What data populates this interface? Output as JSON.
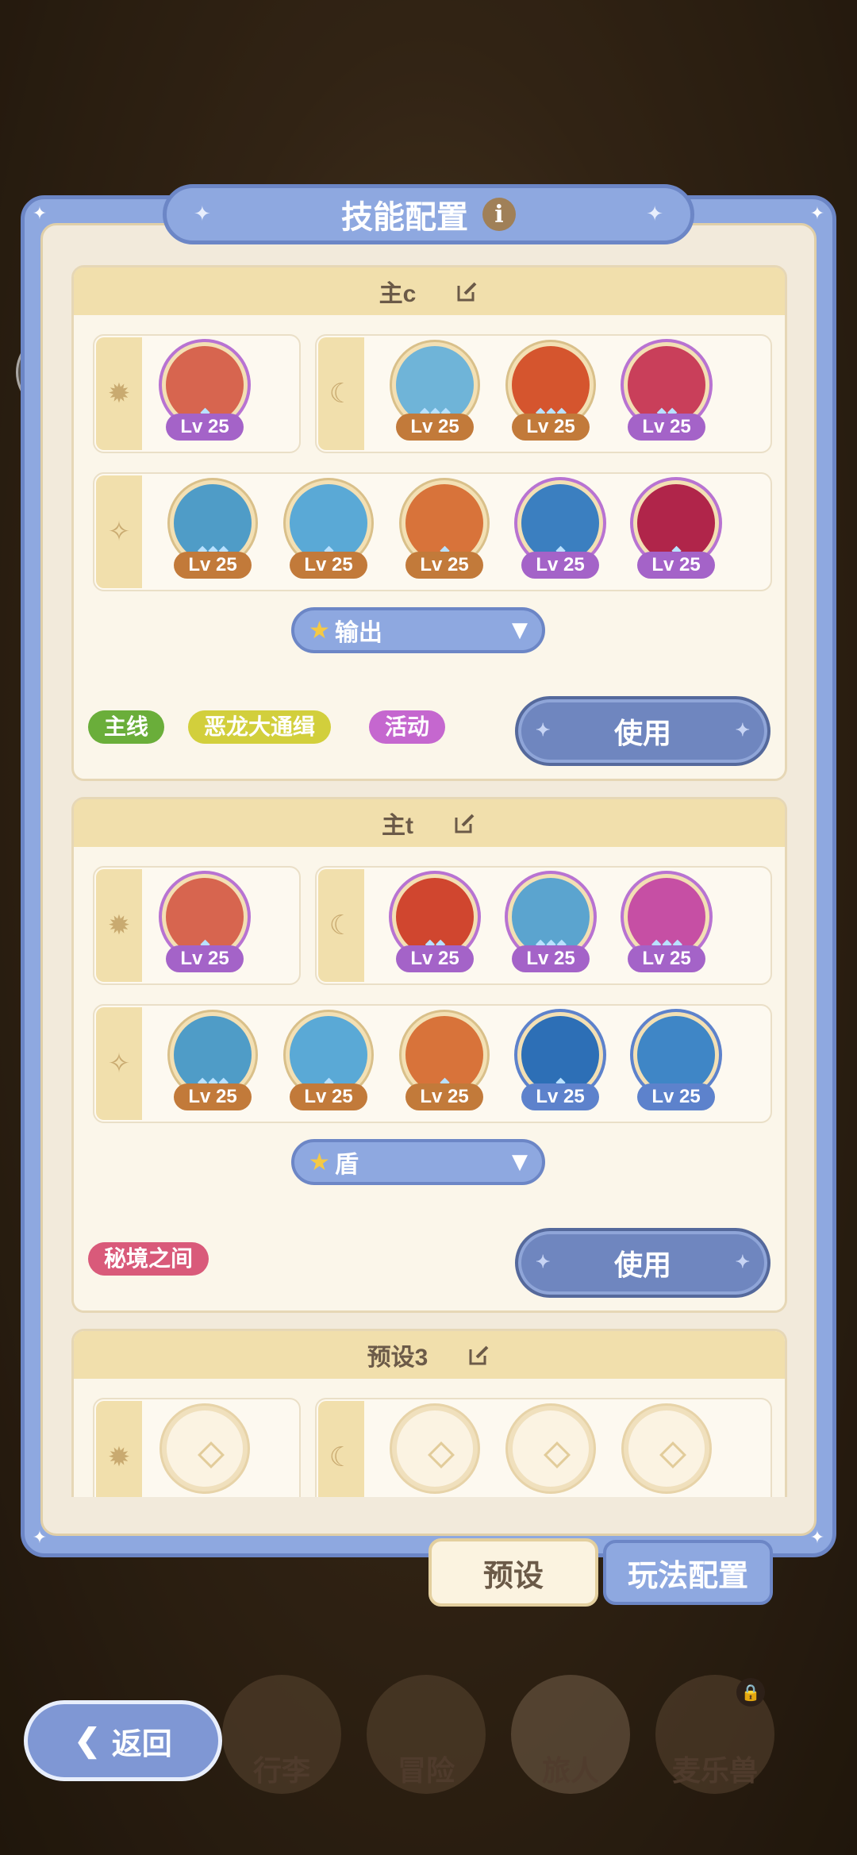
{
  "panel": {
    "title": "技能配置"
  },
  "presets": [
    {
      "name": "主c",
      "slot1": [
        {
          "lv": "Lv 25",
          "color": "purple",
          "bg": "#d7654f"
        }
      ],
      "slot2": [
        {
          "lv": "Lv 25",
          "color": "orange",
          "bg": "#6fb4d8"
        },
        {
          "lv": "Lv 25",
          "color": "orange",
          "bg": "#d5552e"
        },
        {
          "lv": "Lv 25",
          "color": "purple",
          "bg": "#c93f5a"
        }
      ],
      "slot3": [
        {
          "lv": "Lv 25",
          "color": "orange",
          "bg": "#4f9cc7"
        },
        {
          "lv": "Lv 25",
          "color": "orange",
          "bg": "#5aa9d6"
        },
        {
          "lv": "Lv 25",
          "color": "orange",
          "bg": "#d8733a"
        },
        {
          "lv": "Lv 25",
          "color": "purple",
          "bg": "#3b7fc0"
        },
        {
          "lv": "Lv 25",
          "color": "purple",
          "bg": "#b0254a"
        }
      ],
      "dropdown": "输出",
      "tags": [
        {
          "text": "主线",
          "color": "#6aae3a"
        },
        {
          "text": "恶龙大通缉",
          "color": "#d2cf3c"
        },
        {
          "text": "活动",
          "color": "#c567cf"
        }
      ],
      "use_label": "使用"
    },
    {
      "name": "主t",
      "slot1": [
        {
          "lv": "Lv 25",
          "color": "purple",
          "bg": "#d7654f"
        }
      ],
      "slot2": [
        {
          "lv": "Lv 25",
          "color": "purple",
          "bg": "#d0462f"
        },
        {
          "lv": "Lv 25",
          "color": "purple",
          "bg": "#5ba4cf"
        },
        {
          "lv": "Lv 25",
          "color": "purple",
          "bg": "#c64fa4"
        }
      ],
      "slot3": [
        {
          "lv": "Lv 25",
          "color": "orange",
          "bg": "#4f9cc7"
        },
        {
          "lv": "Lv 25",
          "color": "orange",
          "bg": "#5aa9d6"
        },
        {
          "lv": "Lv 25",
          "color": "orange",
          "bg": "#d8733a"
        },
        {
          "lv": "Lv 25",
          "color": "blue",
          "bg": "#2d6fb6"
        },
        {
          "lv": "Lv 25",
          "color": "blue",
          "bg": "#3f86c6"
        }
      ],
      "dropdown": "盾",
      "tags": [
        {
          "text": "秘境之间",
          "color": "#d95a7a"
        }
      ],
      "use_label": "使用"
    },
    {
      "name": "预设3"
    }
  ],
  "tabs": {
    "preset": "预设",
    "gameplay": "玩法配置"
  },
  "nav": {
    "back": "返回",
    "items": [
      "行李",
      "冒险",
      "旅人",
      "麦乐兽"
    ]
  }
}
